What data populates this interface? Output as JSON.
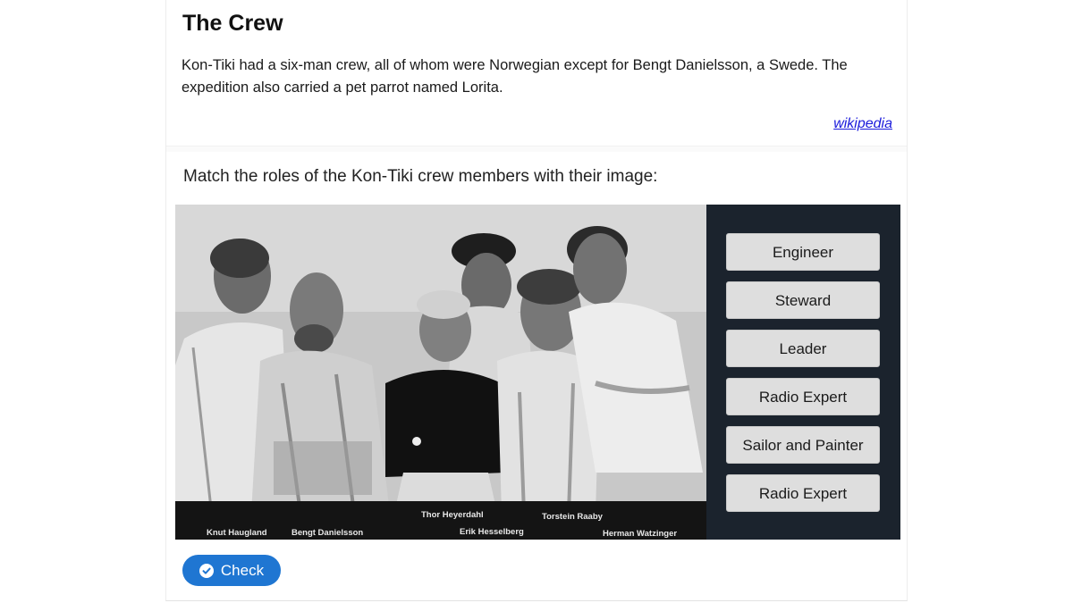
{
  "card": {
    "title": "The Crew",
    "description": "Kon-Tiki had a six-man crew, all of whom were Norwegian except for Bengt Danielsson, a Swede. The expedition also carried a pet parrot named Lorita.",
    "source_link": "wikipedia"
  },
  "quiz": {
    "prompt": "Match the roles of the Kon-Tiki crew members with their image:",
    "photo_captions": [
      "Knut Haugland",
      "Bengt Danielsson",
      "Thor Heyerdahl",
      "Erik Hesselberg",
      "Torstein Raaby",
      "Herman Watzinger"
    ],
    "roles": [
      "Engineer",
      "Steward",
      "Leader",
      "Radio Expert",
      "Sailor and Painter",
      "Radio Expert"
    ],
    "check_label": "Check"
  },
  "colors": {
    "accent": "#1f76d2",
    "panel_bg": "#1b232d",
    "role_button_bg": "#dedede",
    "link": "#1a1adb"
  },
  "icons": {
    "check_button_icon": "check-circle-icon"
  }
}
